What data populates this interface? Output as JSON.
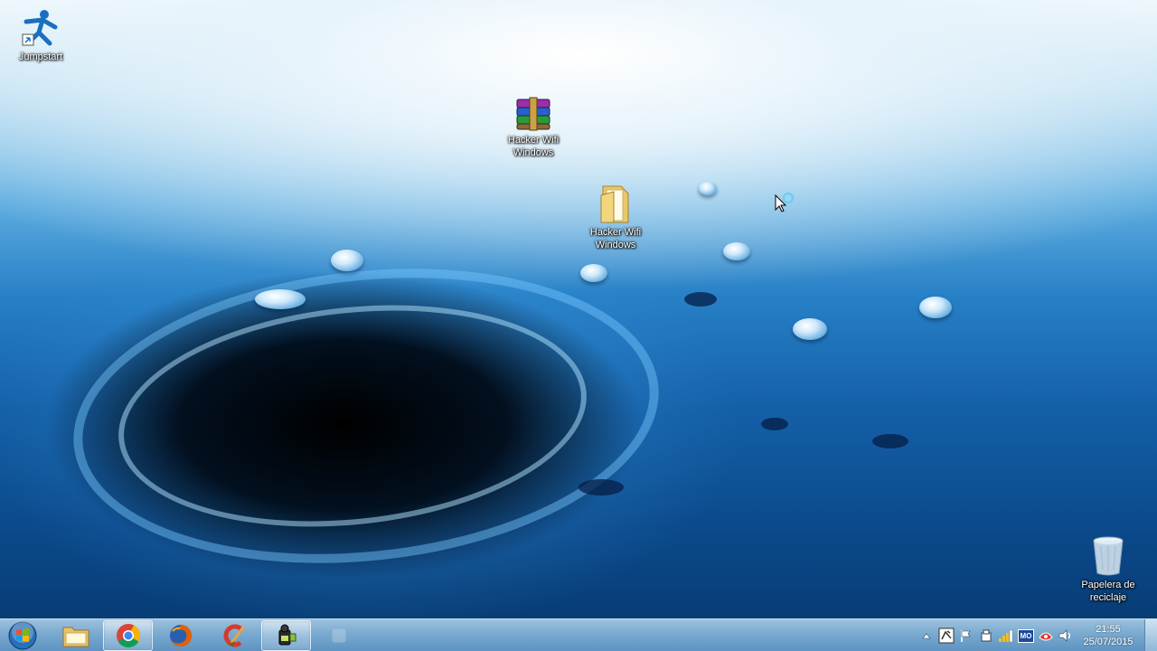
{
  "desktop": {
    "icons": [
      {
        "label": "Jumpstart",
        "icon": "jumpstart-icon"
      },
      {
        "label": "Hacker Wifi Windows",
        "icon": "winrar-archive-icon"
      },
      {
        "label": "Hacker Wifi Windows",
        "icon": "folder-icon"
      },
      {
        "label": "Papelera de reciclaje",
        "icon": "recycle-bin-icon"
      }
    ],
    "cursor": "busy-arrow-cursor"
  },
  "taskbar": {
    "start": "windows-start-orb-icon",
    "pinned": [
      {
        "name": "explorer",
        "icon": "file-explorer-icon",
        "active": false
      },
      {
        "name": "chrome",
        "icon": "chrome-icon",
        "active": true
      },
      {
        "name": "firefox",
        "icon": "firefox-icon",
        "active": false
      },
      {
        "name": "ccleaner",
        "icon": "ccleaner-icon",
        "active": false
      },
      {
        "name": "camtasia",
        "icon": "video-recorder-icon",
        "active": true
      },
      {
        "name": "loading",
        "icon": "loading-app-icon",
        "active": false
      }
    ],
    "tray": {
      "icons": [
        "show-hidden-icons-icon",
        "network-tool-icon",
        "action-center-flag-icon",
        "usb-device-icon",
        "signal-bars-icon",
        "mo-badge-icon",
        "security-icon",
        "volume-icon"
      ],
      "mo_text": "MO",
      "time": "21:55",
      "date": "25/07/2015"
    }
  },
  "colors": {
    "taskbar_top": "#9cc2dd",
    "taskbar_bottom": "#5d93c2",
    "water_deep": "#0b4a8c"
  }
}
